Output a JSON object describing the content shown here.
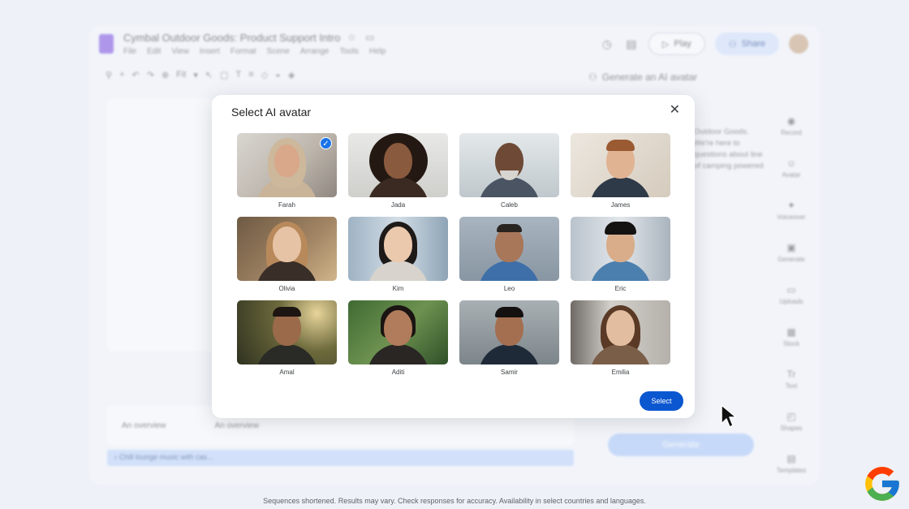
{
  "app": {
    "title": "Cymbal Outdoor Goods: Product Support Intro",
    "menu": [
      "File",
      "Edit",
      "View",
      "Insert",
      "Format",
      "Scene",
      "Arrange",
      "Tools",
      "Help"
    ],
    "play_label": "Play",
    "share_label": "Share",
    "zoom_label": "Fit",
    "timeline_clips": [
      "An overview",
      "An overview"
    ],
    "audio_label": "Chill lounge music with cas...",
    "panel_title": "Generate an AI avatar",
    "panel_text": "Outdoor Goods. We're here to questions about line of camping powered",
    "generate_label": "Generate",
    "rail": [
      "Record",
      "Avatar",
      "Voiceover",
      "Generate",
      "Uploads",
      "Stock",
      "Text",
      "Shapes",
      "Templates"
    ]
  },
  "dialog": {
    "title": "Select AI avatar",
    "select_label": "Select",
    "avatars": [
      {
        "name": "Farah",
        "selected": true
      },
      {
        "name": "Jada",
        "selected": false
      },
      {
        "name": "Caleb",
        "selected": false
      },
      {
        "name": "James",
        "selected": false
      },
      {
        "name": "Olivia",
        "selected": false
      },
      {
        "name": "Kim",
        "selected": false
      },
      {
        "name": "Leo",
        "selected": false
      },
      {
        "name": "Eric",
        "selected": false
      },
      {
        "name": "Amal",
        "selected": false
      },
      {
        "name": "Aditi",
        "selected": false
      },
      {
        "name": "Samir",
        "selected": false
      },
      {
        "name": "Emilia",
        "selected": false
      }
    ]
  },
  "footer": {
    "note": "Sequences shortened. Results may vary. Check responses for accuracy. Availability in select countries and languages."
  },
  "colors": {
    "accent": "#0b57d0",
    "check": "#1a73e8"
  }
}
